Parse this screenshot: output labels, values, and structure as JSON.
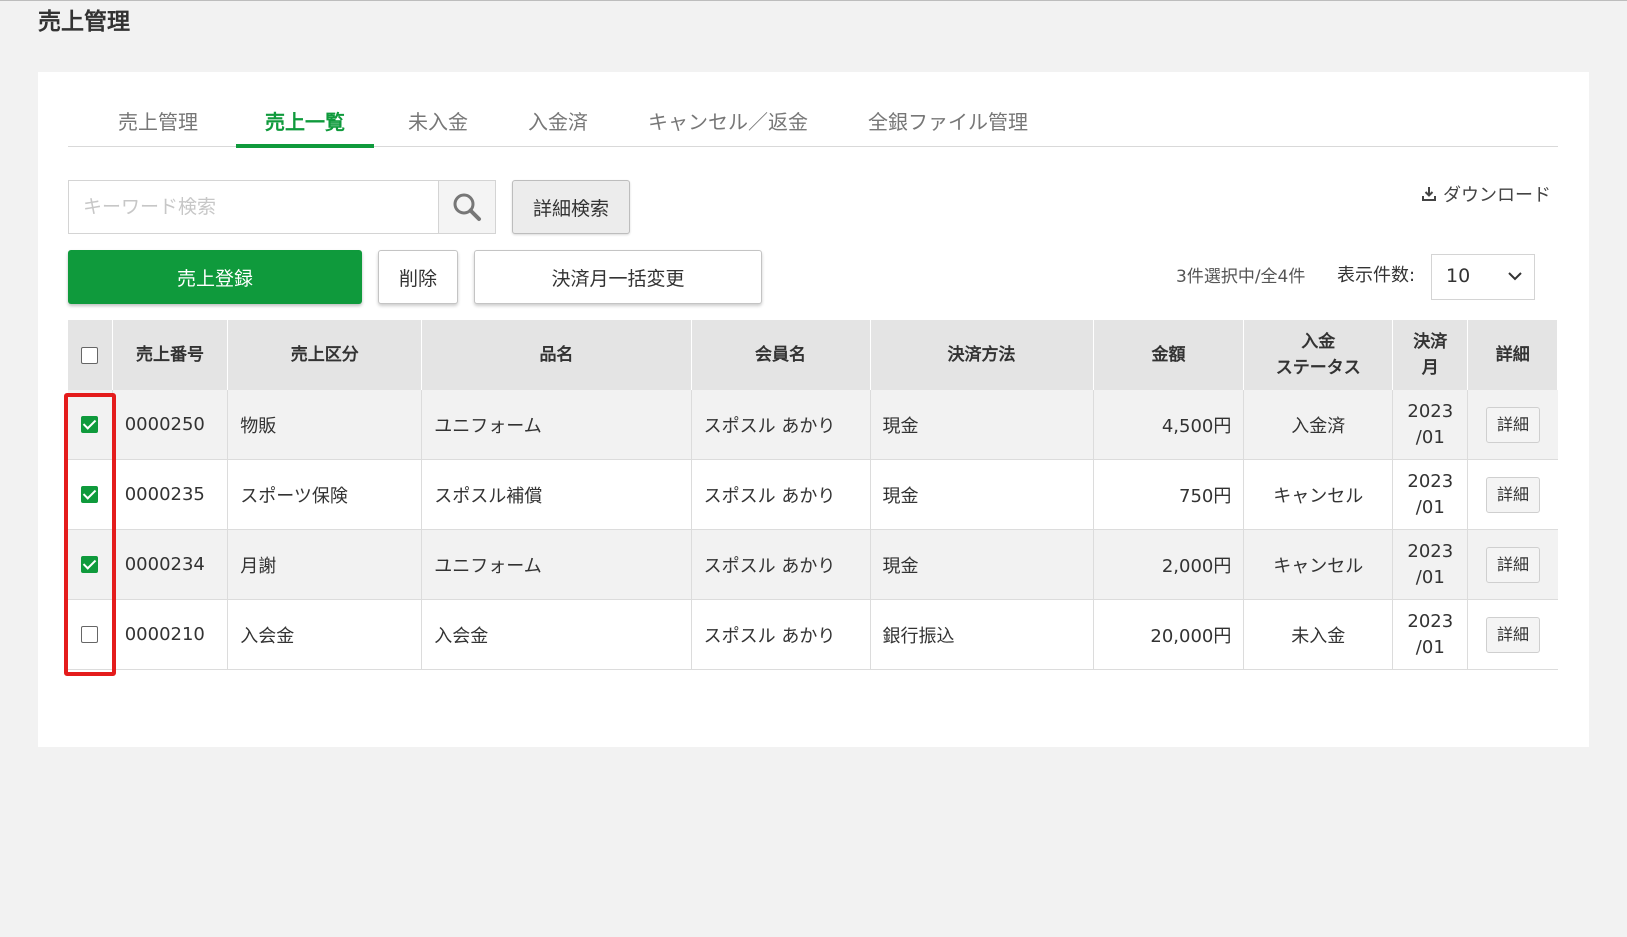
{
  "page": {
    "title": "売上管理"
  },
  "tabs": [
    {
      "label": "売上管理",
      "active": false
    },
    {
      "label": "売上一覧",
      "active": true
    },
    {
      "label": "未入金",
      "active": false
    },
    {
      "label": "入金済",
      "active": false
    },
    {
      "label": "キャンセル／返金",
      "active": false
    },
    {
      "label": "全銀ファイル管理",
      "active": false
    }
  ],
  "search": {
    "placeholder": "キーワード検索",
    "value": "",
    "icon": "search-icon",
    "advanced_label": "詳細検索"
  },
  "download": {
    "label": "ダウンロード",
    "icon": "download-icon"
  },
  "actions": {
    "register_label": "売上登録",
    "delete_label": "削除",
    "bulk_month_label": "決済月一括変更"
  },
  "selection_status": "3件選択中/全4件",
  "page_size": {
    "label": "表示件数:",
    "value": "10"
  },
  "table": {
    "headers": {
      "number": "売上番号",
      "category": "売上区分",
      "item": "品名",
      "member": "会員名",
      "payment_method": "決済方法",
      "amount": "金額",
      "status_line1": "入金",
      "status_line2": "ステータス",
      "month_line1": "決済",
      "month_line2": "月",
      "detail": "詳細"
    },
    "rows": [
      {
        "checked": true,
        "number": "0000250",
        "category": "物販",
        "item": "ユニフォーム",
        "member": "スポスル あかり",
        "payment_method": "現金",
        "amount": "4,500円",
        "status": "入金済",
        "month_year": "2023",
        "month_mon": "/01",
        "detail_label": "詳細"
      },
      {
        "checked": true,
        "number": "0000235",
        "category": "スポーツ保険",
        "item": "スポスル補償",
        "member": "スポスル あかり",
        "payment_method": "現金",
        "amount": "750円",
        "status": "キャンセル",
        "month_year": "2023",
        "month_mon": "/01",
        "detail_label": "詳細"
      },
      {
        "checked": true,
        "number": "0000234",
        "category": "月謝",
        "item": "ユニフォーム",
        "member": "スポスル あかり",
        "payment_method": "現金",
        "amount": "2,000円",
        "status": "キャンセル",
        "month_year": "2023",
        "month_mon": "/01",
        "detail_label": "詳細"
      },
      {
        "checked": false,
        "number": "0000210",
        "category": "入会金",
        "item": "入会金",
        "member": "スポスル あかり",
        "payment_method": "銀行振込",
        "amount": "20,000円",
        "status": "未入金",
        "month_year": "2023",
        "month_mon": "/01",
        "detail_label": "詳細"
      }
    ]
  },
  "colors": {
    "accent": "#0f9a3c",
    "highlight": "#e41c1c",
    "header_bg": "#e4e4e4"
  }
}
